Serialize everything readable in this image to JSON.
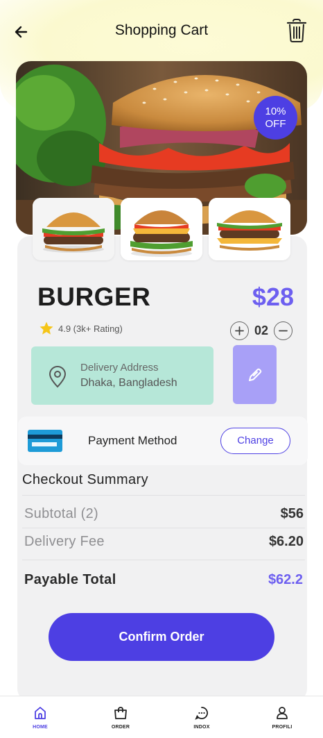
{
  "header": {
    "title": "Shopping Cart",
    "back_icon": "arrow-left-icon",
    "trash_icon": "trash-icon"
  },
  "hero": {
    "discount_line1": "10%",
    "discount_line2": "OFF"
  },
  "product": {
    "name": "BURGER",
    "price": "$28",
    "rating_text": "4.9 (3k+ Rating)",
    "quantity": "02",
    "thumbnails": [
      "burger-thumb-1",
      "burger-thumb-2",
      "burger-thumb-3"
    ]
  },
  "delivery": {
    "label": "Delivery Address",
    "value": "Dhaka, Bangladesh"
  },
  "payment": {
    "label": "Payment Method",
    "change_label": "Change"
  },
  "summary": {
    "title": "Checkout Summary",
    "subtotal_label": "Subtotal (2)",
    "subtotal_value": "$56",
    "delivery_label": "Delivery Fee",
    "delivery_value": "$6.20",
    "total_label": "Payable Total",
    "total_value": "$62.2"
  },
  "confirm_label": "Confirm Order",
  "nav": {
    "items": [
      {
        "label": "HOME",
        "icon": "home-icon",
        "active": true
      },
      {
        "label": "ORDER",
        "icon": "bag-icon",
        "active": false
      },
      {
        "label": "INDOX",
        "icon": "chat-icon",
        "active": false
      },
      {
        "label": "PROFILI",
        "icon": "user-icon",
        "active": false
      }
    ]
  },
  "colors": {
    "accent": "#4d3fe3",
    "price": "#6d5ff0",
    "delivery_bg": "#b6e7d8",
    "edit_bg": "#a8a0f7",
    "star": "#f5c518"
  }
}
